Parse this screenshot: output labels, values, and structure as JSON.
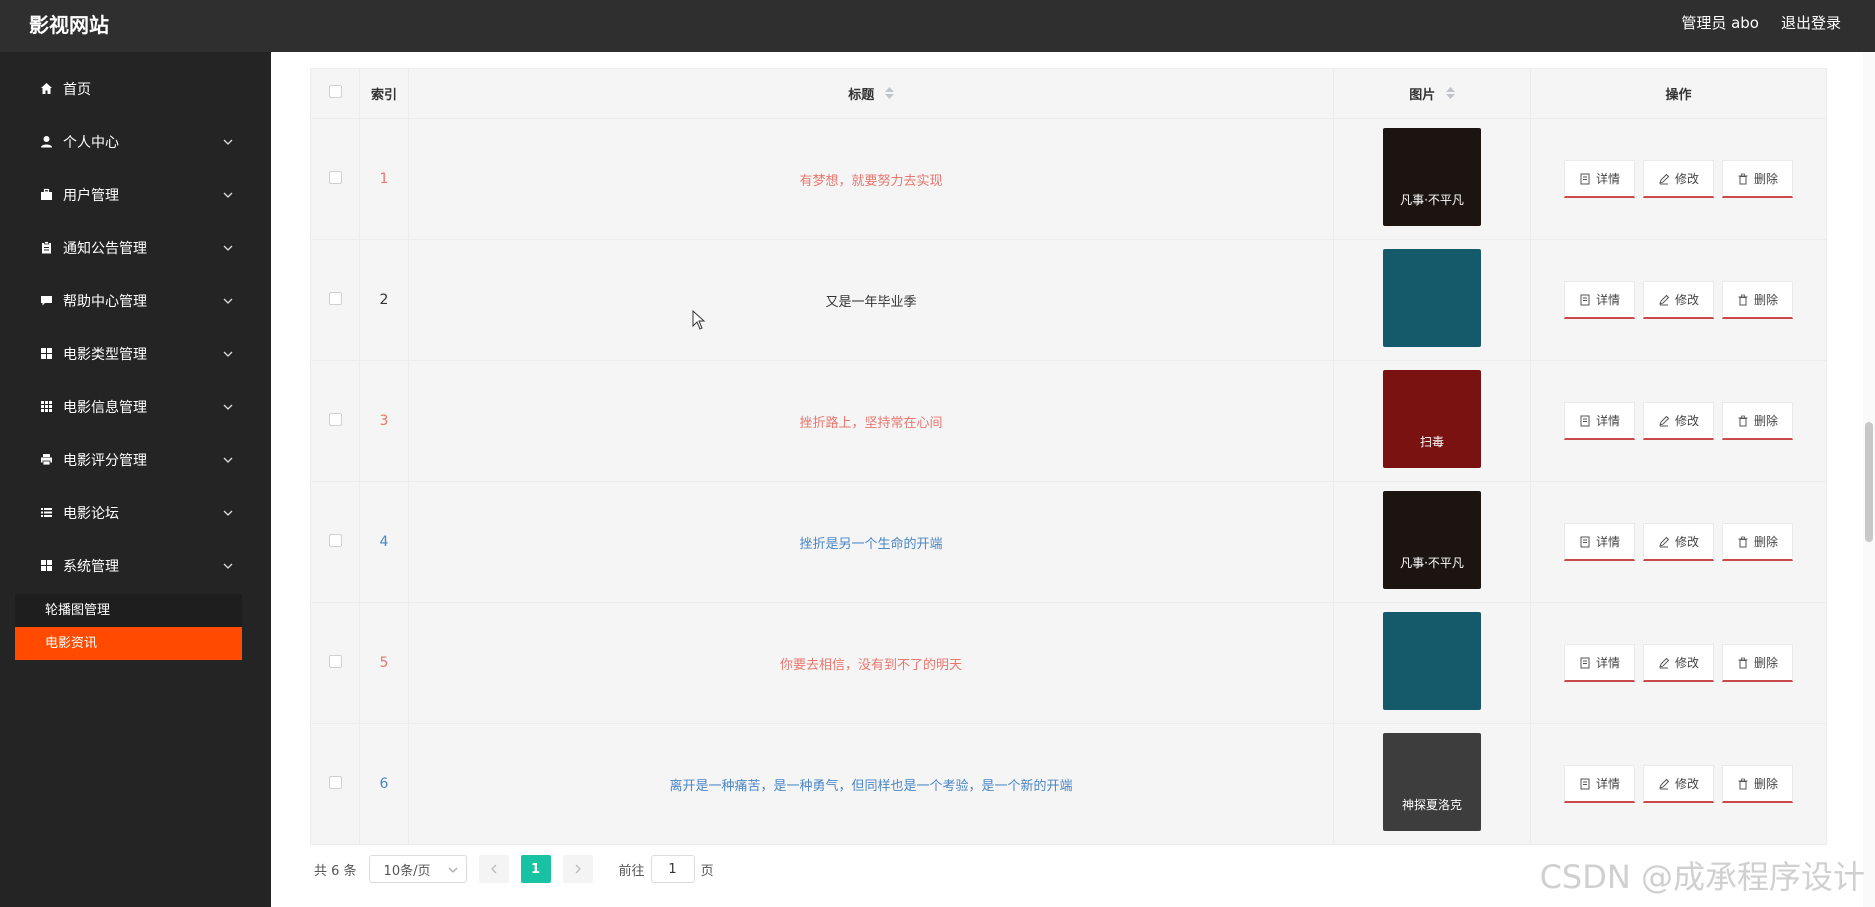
{
  "app": {
    "title": "影视网站",
    "user_label": "管理员 abo",
    "logout_label": "退出登录"
  },
  "sidebar": {
    "items": [
      {
        "label": "首页",
        "icon": "home-icon",
        "has_children": false
      },
      {
        "label": "个人中心",
        "icon": "user-icon",
        "has_children": true
      },
      {
        "label": "用户管理",
        "icon": "briefcase-icon",
        "has_children": true
      },
      {
        "label": "通知公告管理",
        "icon": "clipboard-icon",
        "has_children": true
      },
      {
        "label": "帮助中心管理",
        "icon": "chat-icon",
        "has_children": true
      },
      {
        "label": "电影类型管理",
        "icon": "grid-icon",
        "has_children": true
      },
      {
        "label": "电影信息管理",
        "icon": "grid-dense-icon",
        "has_children": true
      },
      {
        "label": "电影评分管理",
        "icon": "printer-icon",
        "has_children": true
      },
      {
        "label": "电影论坛",
        "icon": "list-icon",
        "has_children": true
      },
      {
        "label": "系统管理",
        "icon": "grid-icon",
        "has_children": true
      }
    ],
    "submenu": [
      {
        "label": "轮播图管理",
        "active": false
      },
      {
        "label": "电影资讯",
        "active": true
      }
    ]
  },
  "table": {
    "headers": {
      "index": "索引",
      "title": "标题",
      "image": "图片",
      "actions": "操作"
    },
    "action_labels": {
      "detail": "详情",
      "edit": "修改",
      "delete": "删除"
    },
    "rows": [
      {
        "index": "1",
        "title": "有梦想，就要努力去实现",
        "color": "#e8776f",
        "poster": "凡事·不平凡",
        "poster_bg": "#1b1410"
      },
      {
        "index": "2",
        "title": "又是一年毕业季",
        "color": "#333333",
        "poster": "",
        "poster_bg": "#145a6b"
      },
      {
        "index": "3",
        "title": "挫折路上，坚持常在心间",
        "color": "#e8776f",
        "poster": "扫毒",
        "poster_bg": "#7a1212"
      },
      {
        "index": "4",
        "title": "挫折是另一个生命的开端",
        "color": "#4a86c5",
        "poster": "凡事·不平凡",
        "poster_bg": "#1b1410"
      },
      {
        "index": "5",
        "title": "你要去相信，没有到不了的明天",
        "color": "#e8776f",
        "poster": "",
        "poster_bg": "#145a6b"
      },
      {
        "index": "6",
        "title": "离开是一种痛苦，是一种勇气，但同样也是一个考验，是一个新的开端",
        "color": "#4a86c5",
        "poster": "神探夏洛克",
        "poster_bg": "#3d3d3d"
      }
    ]
  },
  "pagination": {
    "total": "共 6 条",
    "page_size": "10条/页",
    "current_page": "1",
    "goto_prefix": "前往",
    "goto_value": "1",
    "goto_suffix": "页"
  },
  "watermark": "CSDN @成承程序设计"
}
